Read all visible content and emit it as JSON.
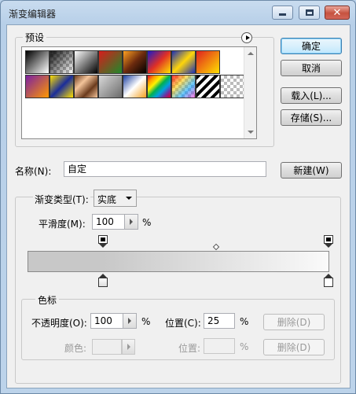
{
  "window": {
    "title": "渐变编辑器"
  },
  "buttons": {
    "ok": "确定",
    "cancel": "取消",
    "load": "载入(L)...",
    "save": "存储(S)...",
    "new": "新建(W)"
  },
  "presets": {
    "legend": "预设"
  },
  "name": {
    "label": "名称(N):",
    "value": "自定"
  },
  "gradient_type": {
    "label": "渐变类型(T):",
    "value": "实底"
  },
  "smoothness": {
    "label": "平滑度(M):",
    "value": "100",
    "unit": "%"
  },
  "stops": {
    "legend": "色标",
    "opacity_label": "不透明度(O):",
    "opacity_value": "100",
    "opacity_unit": "%",
    "location_label": "位置(C):",
    "location_value": "25",
    "location_unit": "%",
    "delete_label": "删除(D)",
    "color_label": "颜色:",
    "color_location_label": "位置:",
    "color_location_unit": "%",
    "color_delete_label": "删除(D)"
  }
}
